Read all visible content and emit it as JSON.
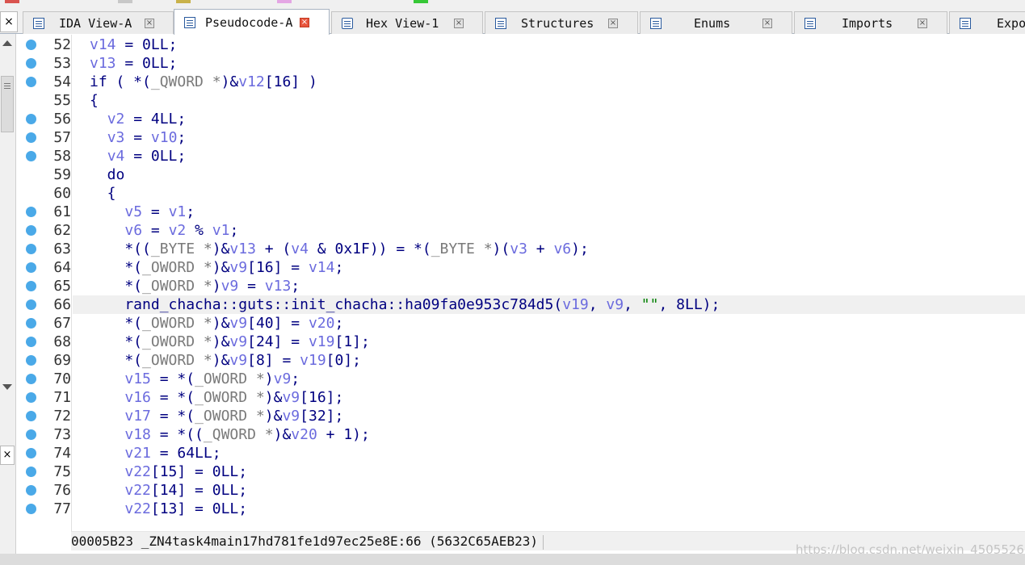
{
  "tabs": [
    {
      "label": "IDA View-A",
      "active": false
    },
    {
      "label": "Pseudocode-A",
      "active": true
    },
    {
      "label": "Hex View-1",
      "active": false
    },
    {
      "label": "Structures",
      "active": false
    },
    {
      "label": "Enums",
      "active": false
    },
    {
      "label": "Imports",
      "active": false
    },
    {
      "label": "Expo",
      "active": false
    }
  ],
  "tab_close_glyph": "×",
  "dock_close_glyph": "×",
  "code_lines": [
    {
      "num": "52",
      "dot": true,
      "tokens": [
        [
          "v",
          "v14"
        ],
        [
          "k",
          " = 0LL;"
        ]
      ]
    },
    {
      "num": "53",
      "dot": true,
      "tokens": [
        [
          "v",
          "v13"
        ],
        [
          "k",
          " = 0LL;"
        ]
      ]
    },
    {
      "num": "54",
      "dot": true,
      "tokens": [
        [
          "k",
          "if ( *("
        ],
        [
          "t",
          "_QWORD *"
        ],
        [
          "k",
          ")&"
        ],
        [
          "v",
          "v12"
        ],
        [
          "k",
          "[16] )"
        ]
      ]
    },
    {
      "num": "55",
      "dot": false,
      "tokens": [
        [
          "k",
          "{"
        ]
      ]
    },
    {
      "num": "56",
      "dot": true,
      "tokens": [
        [
          "k",
          "  "
        ],
        [
          "v",
          "v2"
        ],
        [
          "k",
          " = 4LL;"
        ]
      ]
    },
    {
      "num": "57",
      "dot": true,
      "tokens": [
        [
          "k",
          "  "
        ],
        [
          "v",
          "v3"
        ],
        [
          "k",
          " = "
        ],
        [
          "v",
          "v10"
        ],
        [
          "k",
          ";"
        ]
      ]
    },
    {
      "num": "58",
      "dot": true,
      "tokens": [
        [
          "k",
          "  "
        ],
        [
          "v",
          "v4"
        ],
        [
          "k",
          " = 0LL;"
        ]
      ]
    },
    {
      "num": "59",
      "dot": false,
      "tokens": [
        [
          "k",
          "  do"
        ]
      ]
    },
    {
      "num": "60",
      "dot": false,
      "tokens": [
        [
          "k",
          "  {"
        ]
      ]
    },
    {
      "num": "61",
      "dot": true,
      "tokens": [
        [
          "k",
          "    "
        ],
        [
          "v",
          "v5"
        ],
        [
          "k",
          " = "
        ],
        [
          "v",
          "v1"
        ],
        [
          "k",
          ";"
        ]
      ]
    },
    {
      "num": "62",
      "dot": true,
      "tokens": [
        [
          "k",
          "    "
        ],
        [
          "v",
          "v6"
        ],
        [
          "k",
          " = "
        ],
        [
          "v",
          "v2"
        ],
        [
          "k",
          " % "
        ],
        [
          "v",
          "v1"
        ],
        [
          "k",
          ";"
        ]
      ]
    },
    {
      "num": "63",
      "dot": true,
      "tokens": [
        [
          "k",
          "    *(("
        ],
        [
          "t",
          "_BYTE *"
        ],
        [
          "k",
          ")&"
        ],
        [
          "v",
          "v13"
        ],
        [
          "k",
          " + ("
        ],
        [
          "v",
          "v4"
        ],
        [
          "k",
          " & 0x1F)) = *("
        ],
        [
          "t",
          "_BYTE *"
        ],
        [
          "k",
          ")("
        ],
        [
          "v",
          "v3"
        ],
        [
          "k",
          " + "
        ],
        [
          "v",
          "v6"
        ],
        [
          "k",
          ");"
        ]
      ]
    },
    {
      "num": "64",
      "dot": true,
      "tokens": [
        [
          "k",
          "    *("
        ],
        [
          "t",
          "_OWORD *"
        ],
        [
          "k",
          ")&"
        ],
        [
          "v",
          "v9"
        ],
        [
          "k",
          "[16] = "
        ],
        [
          "v",
          "v14"
        ],
        [
          "k",
          ";"
        ]
      ]
    },
    {
      "num": "65",
      "dot": true,
      "tokens": [
        [
          "k",
          "    *("
        ],
        [
          "t",
          "_OWORD *"
        ],
        [
          "k",
          ")"
        ],
        [
          "v",
          "v9"
        ],
        [
          "k",
          " = "
        ],
        [
          "v",
          "v13"
        ],
        [
          "k",
          ";"
        ]
      ]
    },
    {
      "num": "66",
      "dot": true,
      "hl": true,
      "tokens": [
        [
          "k",
          "    rand_chacha::guts::init_chacha::ha09fa0e953c784d5("
        ],
        [
          "v",
          "v19"
        ],
        [
          "k",
          ", "
        ],
        [
          "v",
          "v9"
        ],
        [
          "k",
          ", "
        ],
        [
          "s",
          "\"\""
        ],
        [
          "k",
          ", 8LL);"
        ]
      ]
    },
    {
      "num": "67",
      "dot": true,
      "tokens": [
        [
          "k",
          "    *("
        ],
        [
          "t",
          "_OWORD *"
        ],
        [
          "k",
          ")&"
        ],
        [
          "v",
          "v9"
        ],
        [
          "k",
          "[40] = "
        ],
        [
          "v",
          "v20"
        ],
        [
          "k",
          ";"
        ]
      ]
    },
    {
      "num": "68",
      "dot": true,
      "tokens": [
        [
          "k",
          "    *("
        ],
        [
          "t",
          "_OWORD *"
        ],
        [
          "k",
          ")&"
        ],
        [
          "v",
          "v9"
        ],
        [
          "k",
          "[24] = "
        ],
        [
          "v",
          "v19"
        ],
        [
          "k",
          "[1];"
        ]
      ]
    },
    {
      "num": "69",
      "dot": true,
      "tokens": [
        [
          "k",
          "    *("
        ],
        [
          "t",
          "_OWORD *"
        ],
        [
          "k",
          ")&"
        ],
        [
          "v",
          "v9"
        ],
        [
          "k",
          "[8] = "
        ],
        [
          "v",
          "v19"
        ],
        [
          "k",
          "[0];"
        ]
      ]
    },
    {
      "num": "70",
      "dot": true,
      "tokens": [
        [
          "k",
          "    "
        ],
        [
          "v",
          "v15"
        ],
        [
          "k",
          " = *("
        ],
        [
          "t",
          "_OWORD *"
        ],
        [
          "k",
          ")"
        ],
        [
          "v",
          "v9"
        ],
        [
          "k",
          ";"
        ]
      ]
    },
    {
      "num": "71",
      "dot": true,
      "tokens": [
        [
          "k",
          "    "
        ],
        [
          "v",
          "v16"
        ],
        [
          "k",
          " = *("
        ],
        [
          "t",
          "_OWORD *"
        ],
        [
          "k",
          ")&"
        ],
        [
          "v",
          "v9"
        ],
        [
          "k",
          "[16];"
        ]
      ]
    },
    {
      "num": "72",
      "dot": true,
      "tokens": [
        [
          "k",
          "    "
        ],
        [
          "v",
          "v17"
        ],
        [
          "k",
          " = *("
        ],
        [
          "t",
          "_OWORD *"
        ],
        [
          "k",
          ")&"
        ],
        [
          "v",
          "v9"
        ],
        [
          "k",
          "[32];"
        ]
      ]
    },
    {
      "num": "73",
      "dot": true,
      "tokens": [
        [
          "k",
          "    "
        ],
        [
          "v",
          "v18"
        ],
        [
          "k",
          " = *(("
        ],
        [
          "t",
          "_QWORD *"
        ],
        [
          "k",
          ")&"
        ],
        [
          "v",
          "v20"
        ],
        [
          "k",
          " + 1);"
        ]
      ]
    },
    {
      "num": "74",
      "dot": true,
      "tokens": [
        [
          "k",
          "    "
        ],
        [
          "v",
          "v21"
        ],
        [
          "k",
          " = 64LL;"
        ]
      ]
    },
    {
      "num": "75",
      "dot": true,
      "tokens": [
        [
          "k",
          "    "
        ],
        [
          "v",
          "v22"
        ],
        [
          "k",
          "[15] = 0LL;"
        ]
      ]
    },
    {
      "num": "76",
      "dot": true,
      "tokens": [
        [
          "k",
          "    "
        ],
        [
          "v",
          "v22"
        ],
        [
          "k",
          "[14] = 0LL;"
        ]
      ]
    },
    {
      "num": "77",
      "dot": true,
      "tokens": [
        [
          "k",
          "    "
        ],
        [
          "v",
          "v22"
        ],
        [
          "k",
          "[13] = 0LL;"
        ]
      ]
    }
  ],
  "status": {
    "text": "00005B23 _ZN4task4main17hd781fe1d97ec25e8E:66 (5632C65AEB23)"
  },
  "watermark": "https://blog.csdn.net/weixin_45055269",
  "colors": {
    "variable": "#6b6bde",
    "type": "#7a7a7a",
    "keyword": "#000080",
    "string": "#008000",
    "breakpoint_dot": "#4aa9e8",
    "highlight_line": "#f0f0f0"
  }
}
